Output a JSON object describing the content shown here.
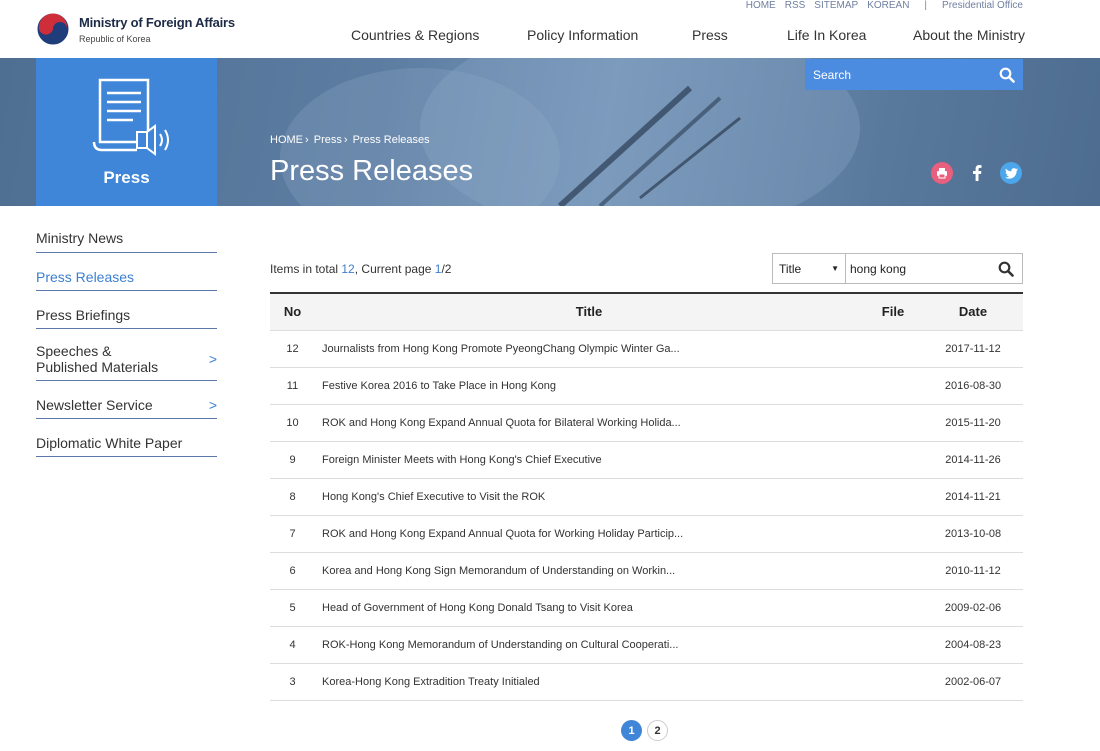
{
  "site": {
    "name": "Ministry of Foreign Affairs",
    "subtitle": "Republic of Korea"
  },
  "util_links": [
    "HOME",
    "RSS",
    "SITEMAP",
    "KOREAN"
  ],
  "util_separator": "|",
  "util_extra": "Presidential Office",
  "nav": [
    "Countries & Regions",
    "Policy Information",
    "Press",
    "Life In Korea",
    "About the Ministry"
  ],
  "banner": {
    "section_label": "Press",
    "breadcrumb": [
      "HOME",
      "›",
      "Press",
      "›",
      "Press Releases"
    ],
    "title": "Press Releases",
    "search_placeholder": "Search"
  },
  "sidebar": [
    {
      "label": "Ministry News",
      "active": false,
      "has_arrow": false
    },
    {
      "label": "Press Releases",
      "active": true,
      "has_arrow": false
    },
    {
      "label": "Press Briefings",
      "active": false,
      "has_arrow": false
    },
    {
      "label": "Speeches & Published Materials",
      "active": false,
      "has_arrow": true
    },
    {
      "label": "Newsletter Service",
      "active": false,
      "has_arrow": true
    },
    {
      "label": "Diplomatic White Paper",
      "active": false,
      "has_arrow": false
    }
  ],
  "list_info": {
    "prefix": "Items in total ",
    "total": "12",
    "middle": ", Current page ",
    "page": "1",
    "suffix": "/2"
  },
  "filter": {
    "field": "Title",
    "keyword": "hong kong"
  },
  "table": {
    "headers": {
      "no": "No",
      "title": "Title",
      "file": "File",
      "date": "Date"
    },
    "rows": [
      {
        "no": "12",
        "title": "Journalists from Hong Kong Promote PyeongChang Olympic Winter Ga...",
        "file": "",
        "date": "2017-11-12"
      },
      {
        "no": "11",
        "title": "Festive Korea 2016 to Take Place in Hong Kong",
        "file": "",
        "date": "2016-08-30"
      },
      {
        "no": "10",
        "title": "ROK and Hong Kong Expand Annual Quota for Bilateral Working Holida...",
        "file": "",
        "date": "2015-11-20"
      },
      {
        "no": "9",
        "title": "Foreign Minister Meets with Hong Kong's Chief Executive",
        "file": "",
        "date": "2014-11-26"
      },
      {
        "no": "8",
        "title": "Hong Kong's Chief Executive to Visit the ROK",
        "file": "",
        "date": "2014-11-21"
      },
      {
        "no": "7",
        "title": "ROK and Hong Kong Expand Annual Quota for Working Holiday Particip...",
        "file": "",
        "date": "2013-10-08"
      },
      {
        "no": "6",
        "title": "Korea and Hong Kong Sign Memorandum of Understanding on Workin...",
        "file": "",
        "date": "2010-11-12"
      },
      {
        "no": "5",
        "title": "Head of Government of Hong Kong Donald Tsang to Visit Korea",
        "file": "",
        "date": "2009-02-06"
      },
      {
        "no": "4",
        "title": "ROK-Hong Kong Memorandum of Understanding on Cultural Cooperati...",
        "file": "",
        "date": "2004-08-23"
      },
      {
        "no": "3",
        "title": "Korea-Hong Kong Extradition Treaty Initialed",
        "file": "",
        "date": "2002-06-07"
      }
    ]
  },
  "pagination": [
    "1",
    "2"
  ],
  "colors": {
    "accent": "#3f86d9",
    "banner": "#5a7a9e",
    "print": "#e8607e",
    "twitter": "#4ba6eb"
  }
}
